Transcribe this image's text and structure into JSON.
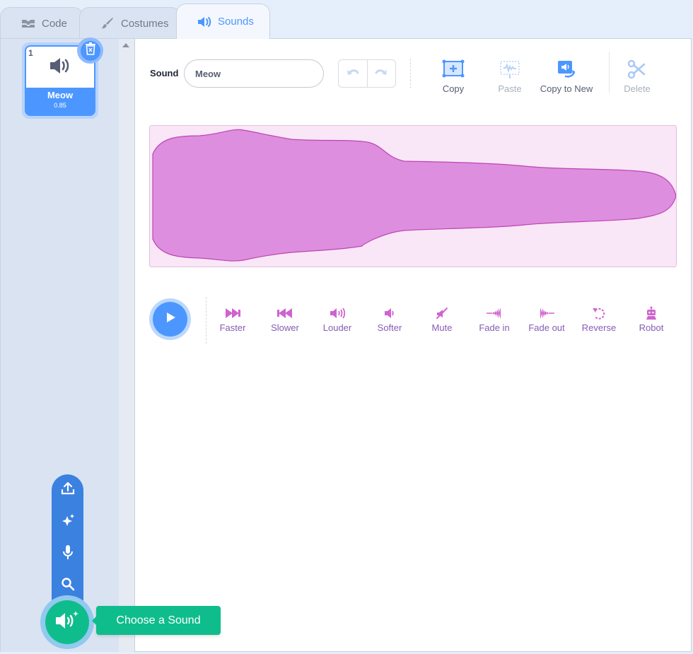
{
  "tabs": [
    {
      "label": "Code",
      "icon": "code-icon",
      "active": false
    },
    {
      "label": "Costumes",
      "icon": "brush-icon",
      "active": false
    },
    {
      "label": "Sounds",
      "icon": "speaker-icon",
      "active": true
    }
  ],
  "sound_list": [
    {
      "index": "1",
      "name": "Meow",
      "duration": "0.85",
      "selected": true
    }
  ],
  "editor": {
    "sound_label": "Sound",
    "sound_name": "Meow",
    "tools": [
      {
        "label": "Copy",
        "icon": "copy-icon",
        "enabled": true
      },
      {
        "label": "Paste",
        "icon": "paste-icon",
        "enabled": false
      },
      {
        "label": "Copy to New",
        "icon": "copy-to-new-icon",
        "enabled": true
      },
      {
        "label": "Delete",
        "icon": "scissors-icon",
        "enabled": false
      }
    ],
    "effects": [
      {
        "label": "Faster",
        "icon": "faster-icon"
      },
      {
        "label": "Slower",
        "icon": "slower-icon"
      },
      {
        "label": "Louder",
        "icon": "louder-icon"
      },
      {
        "label": "Softer",
        "icon": "softer-icon"
      },
      {
        "label": "Mute",
        "icon": "mute-icon"
      },
      {
        "label": "Fade in",
        "icon": "fade-in-icon"
      },
      {
        "label": "Fade out",
        "icon": "fade-out-icon"
      },
      {
        "label": "Reverse",
        "icon": "reverse-icon"
      },
      {
        "label": "Robot",
        "icon": "robot-icon"
      }
    ]
  },
  "add_menu": {
    "items": [
      "upload-icon",
      "surprise-icon",
      "microphone-icon",
      "search-icon"
    ],
    "tooltip": "Choose a Sound"
  },
  "colors": {
    "accent": "#4c97ff",
    "sound_purple": "#cf63cf",
    "effect_purple": "#855cb5",
    "add_green": "#0fbd8c"
  }
}
